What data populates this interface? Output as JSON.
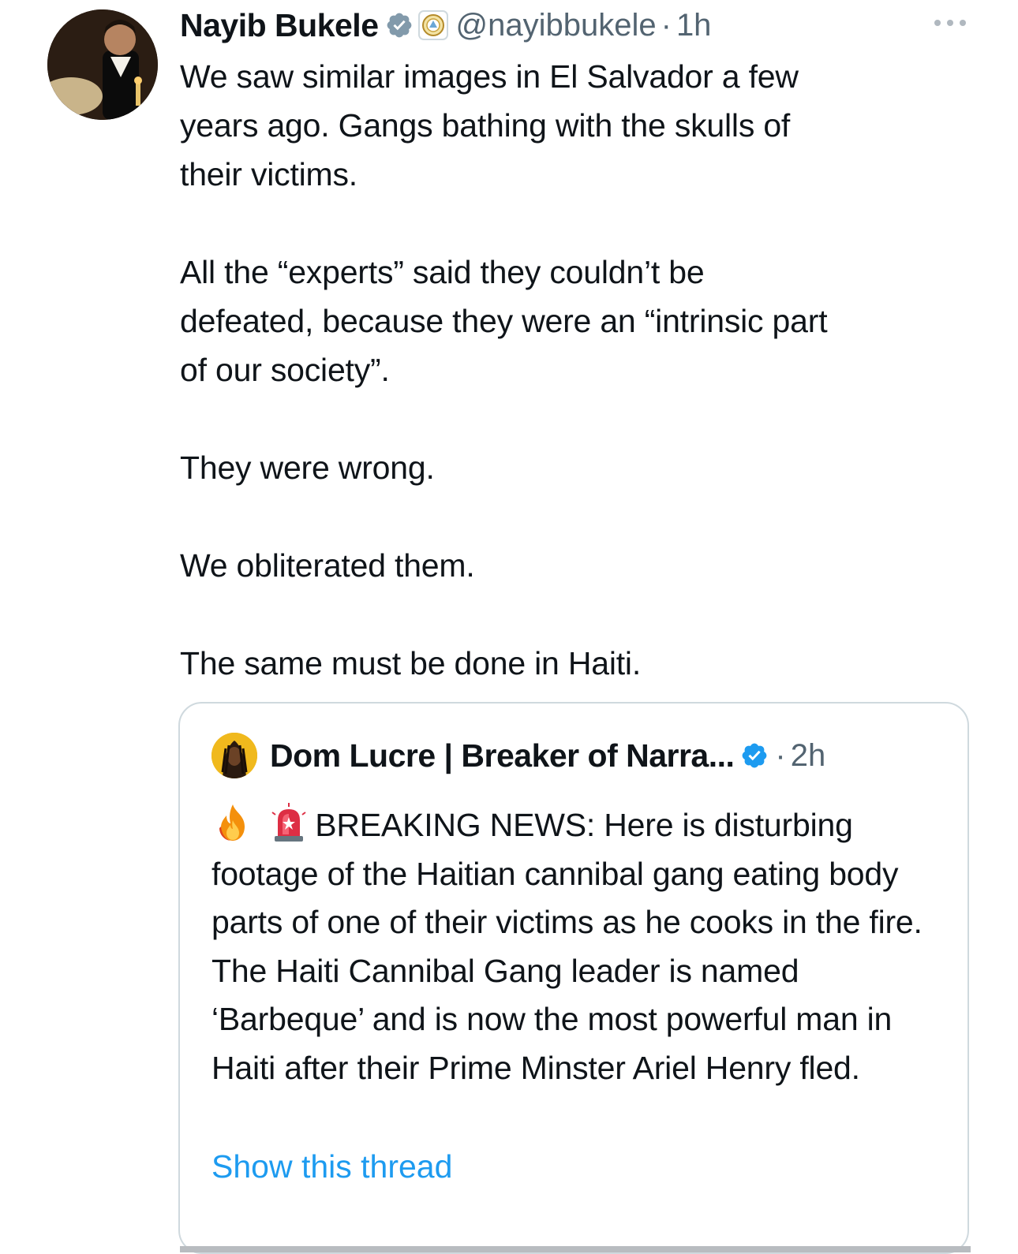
{
  "tweet": {
    "display_name": "Nayib Bukele",
    "handle": "@nayibbukele",
    "separator": "·",
    "time": "1h",
    "body": "We saw similar images in El Salvador a few\nyears ago. Gangs bathing with the skulls of\ntheir victims.\n\nAll the “experts” said they couldn’t be\ndefeated, because they were an “intrinsic part\nof our society”.\n\nThey were wrong.\n\nWe obliterated them.\n\nThe same must be done in Haiti.",
    "badge_color": "#829aab",
    "icons": [
      "avatar",
      "verified-badge-icon",
      "affiliation-seal-icon",
      "more-options-icon"
    ]
  },
  "quoted_tweet": {
    "display_name": "Dom Lucre | Breaker of Narra...",
    "separator": "·",
    "time": "2h",
    "body_after_emojis": "BREAKING NEWS: Here is disturbing footage of the Haitian cannibal gang eating body parts of one of their victims as he cooks in the fire. The Haiti Cannibal Gang leader is named ‘Barbeque’ and is now the most powerful man in Haiti after their Prime Minster Ariel Henry fled.",
    "emojis": [
      "fire-emoji-icon",
      "siren-emoji-icon"
    ],
    "show_thread_label": "Show this thread",
    "badge_color": "#1d9bf0"
  },
  "colors": {
    "text": "#0f1419",
    "secondary": "#536471",
    "link": "#1d9bf0",
    "border": "#cfd9de"
  }
}
